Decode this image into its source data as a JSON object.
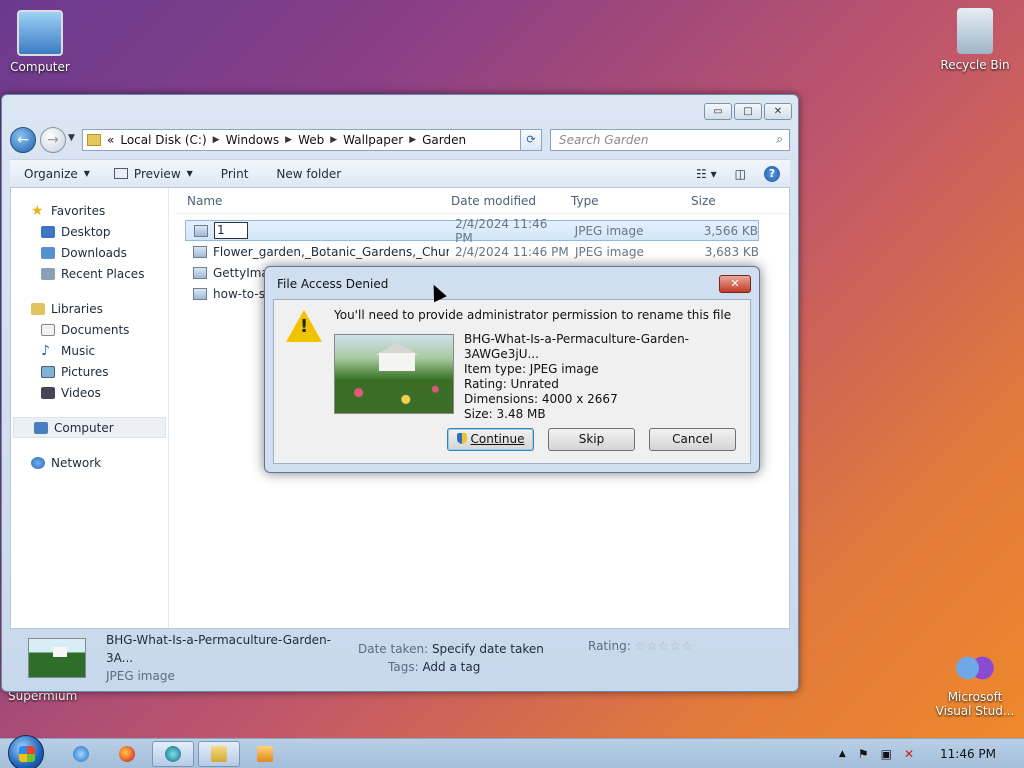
{
  "desktop": {
    "icons": [
      {
        "label": "Computer"
      },
      {
        "label": "Recycle Bin"
      },
      {
        "label": "Microsoft Visual Stud..."
      }
    ],
    "stray_label": "Supermium"
  },
  "explorer": {
    "address": {
      "overflow": "«",
      "crumbs": [
        "Local Disk (C:)",
        "Windows",
        "Web",
        "Wallpaper",
        "Garden"
      ]
    },
    "search_placeholder": "Search Garden",
    "toolbar": {
      "organize": "Organize",
      "preview": "Preview",
      "print": "Print",
      "new_folder": "New folder"
    },
    "sidebar": {
      "favorites": {
        "label": "Favorites",
        "items": [
          "Desktop",
          "Downloads",
          "Recent Places"
        ]
      },
      "libraries": {
        "label": "Libraries",
        "items": [
          "Documents",
          "Music",
          "Pictures",
          "Videos"
        ]
      },
      "computer": "Computer",
      "network": "Network"
    },
    "columns": [
      "Name",
      "Date modified",
      "Type",
      "Size"
    ],
    "files": [
      {
        "name": "1",
        "date": "2/4/2024 11:46 PM",
        "type": "JPEG image",
        "size": "3,566 KB"
      },
      {
        "name": "Flower_garden,_Botanic_Gardens,_Churc...",
        "date": "2/4/2024 11:46 PM",
        "type": "JPEG image",
        "size": "3,683 KB"
      },
      {
        "name": "GettyImage",
        "date": "",
        "type": "",
        "size": ""
      },
      {
        "name": "how-to-sta",
        "date": "",
        "type": "",
        "size": ""
      }
    ],
    "details": {
      "filename": "BHG-What-Is-a-Permaculture-Garden-3A...",
      "type": "JPEG image",
      "date_taken_label": "Date taken:",
      "date_taken_value": "Specify date taken",
      "tags_label": "Tags:",
      "tags_value": "Add a tag",
      "rating_label": "Rating:",
      "rating_stars": "☆☆☆☆☆"
    }
  },
  "dialog": {
    "title": "File Access Denied",
    "close": "✕",
    "message": "You'll need to provide administrator permission to rename this file",
    "file": {
      "name": "BHG-What-Is-a-Permaculture-Garden-3AWGe3jU...",
      "item_type": "Item type: JPEG image",
      "rating": "Rating: Unrated",
      "dimensions": "Dimensions: 4000 x 2667",
      "size": "Size: 3.48 MB"
    },
    "buttons": {
      "continue": "Continue",
      "skip": "Skip",
      "cancel": "Cancel"
    }
  },
  "taskbar": {
    "clock": "11:46 PM"
  }
}
